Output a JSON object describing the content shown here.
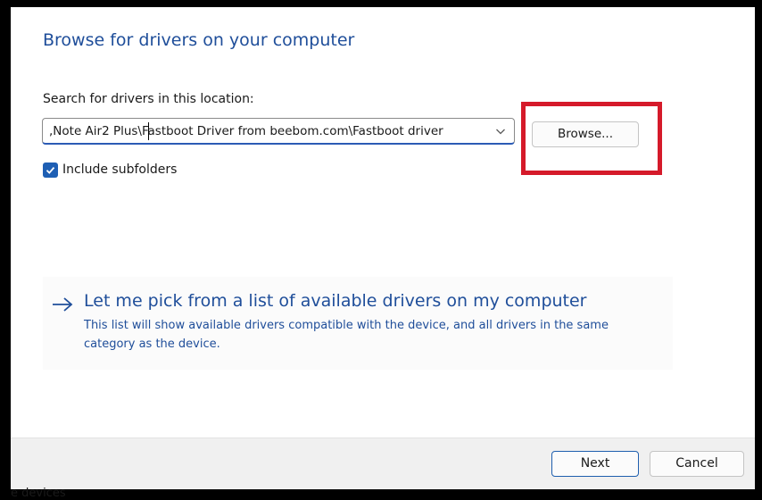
{
  "dialog": {
    "title": "Browse for drivers on your computer",
    "search_label": "Search for drivers in this location:",
    "path_value": ",Note Air2 Plus\\Fastboot Driver from beebom.com\\Fastboot driver",
    "browse_label": "Browse...",
    "include_subfolders_label": "Include subfolders",
    "include_subfolders_checked": true,
    "pick_title": "Let me pick from a list of available drivers on my computer",
    "pick_description": "This list will show available drivers compatible with the device, and all drivers in the same category as the device."
  },
  "footer": {
    "next_label": "Next",
    "cancel_label": "Cancel"
  },
  "background": {
    "partial_text": "e devices"
  },
  "colors": {
    "accent": "#1f4e9a",
    "checkbox": "#1e5fb4",
    "highlight": "#d51a2a",
    "frame": "#000000"
  },
  "icons": {
    "dropdown": "chevron-down-icon",
    "check": "checkmark-icon",
    "pick_arrow": "arrow-right-icon"
  }
}
